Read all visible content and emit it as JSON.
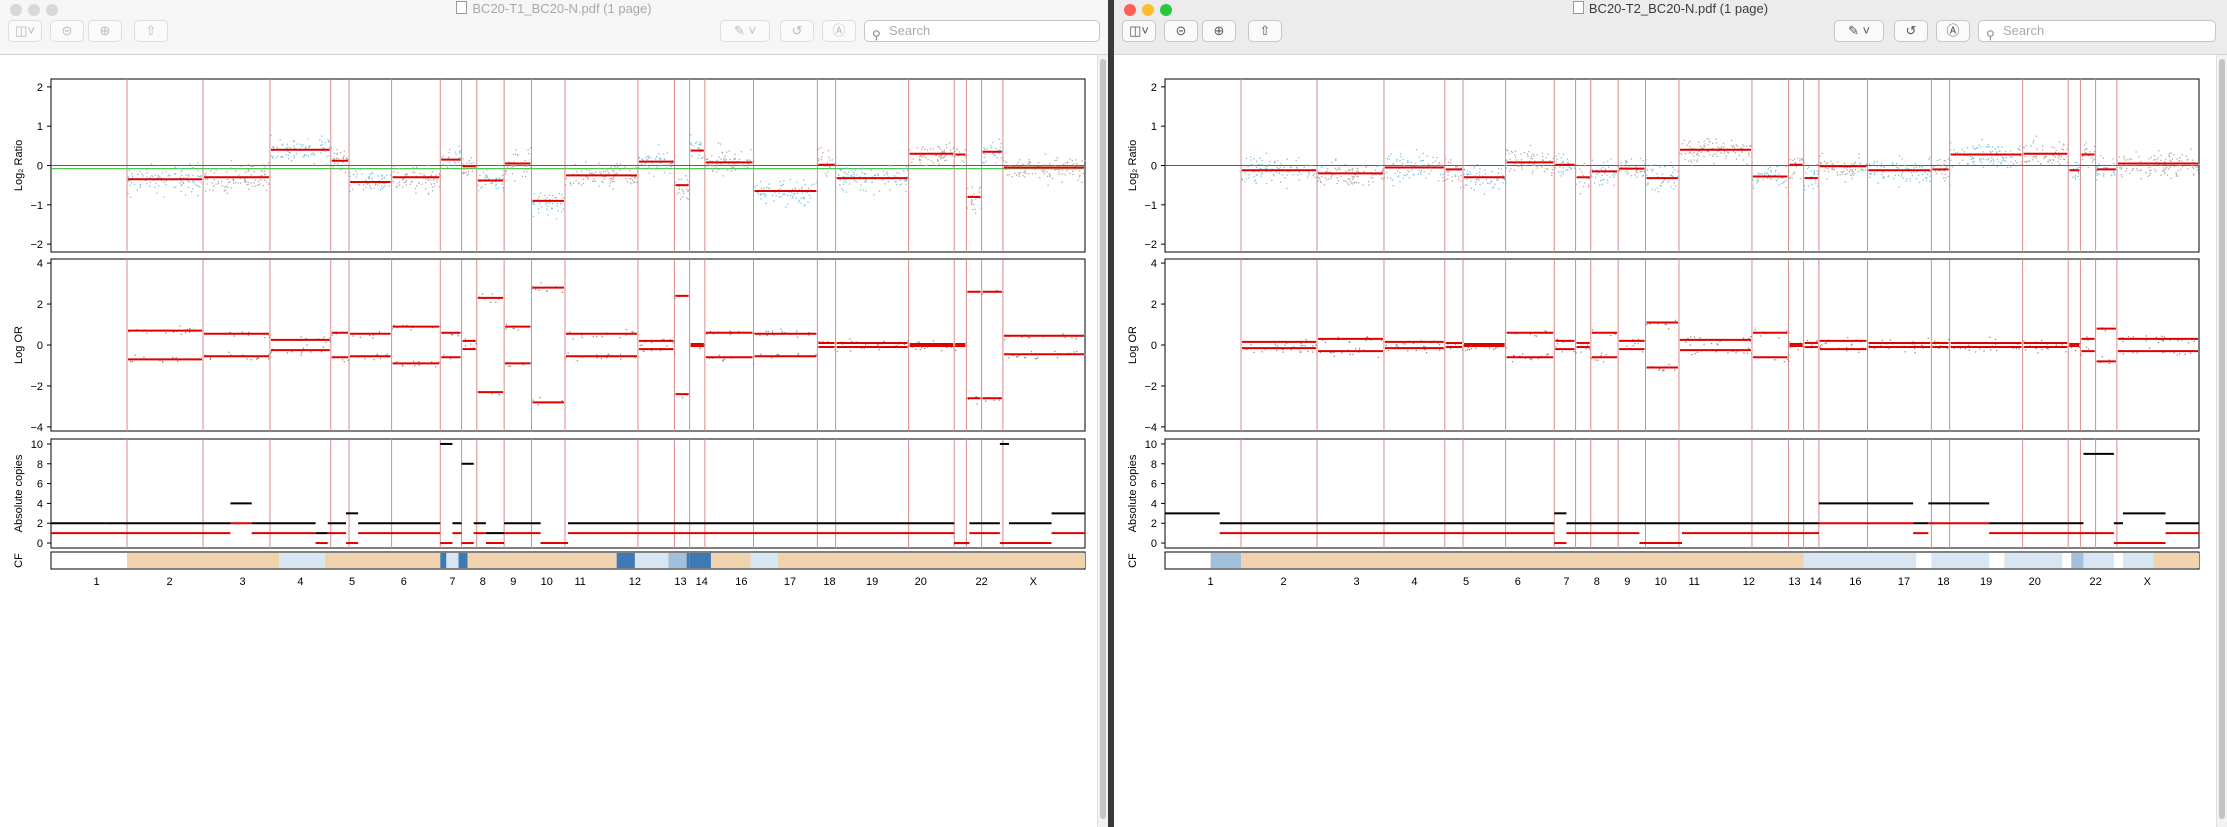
{
  "windows": [
    {
      "id": "left",
      "title": "BC20-T1_BC20-N.pdf (1 page)",
      "active": false,
      "search_placeholder": "Search",
      "cn_tracks": [
        [
          [
            0,
            1.8,
            2
          ],
          [
            1.8,
            5.9,
            2
          ],
          [
            5.9,
            6.6,
            4
          ],
          [
            6.6,
            8.7,
            2
          ],
          [
            8.7,
            9.1,
            1
          ],
          [
            9.1,
            9.7,
            2
          ],
          [
            9.7,
            10.1,
            3
          ],
          [
            10.1,
            12.8,
            2
          ],
          [
            12.8,
            13.2,
            10
          ],
          [
            13.2,
            13.5,
            2
          ],
          [
            13.5,
            13.9,
            8
          ],
          [
            13.9,
            14.3,
            2
          ],
          [
            14.3,
            14.9,
            1
          ],
          [
            14.9,
            16.1,
            2
          ],
          [
            16.1,
            17.0,
            0
          ],
          [
            17.0,
            29.7,
            2
          ],
          [
            29.7,
            30.2,
            0
          ],
          [
            30.2,
            31.2,
            2
          ],
          [
            31.2,
            31.5,
            10
          ],
          [
            31.5,
            32.9,
            2
          ],
          [
            32.9,
            34.0,
            3
          ]
        ],
        [
          [
            0,
            5.9,
            1
          ],
          [
            5.9,
            6.6,
            2
          ],
          [
            6.6,
            8.7,
            1
          ],
          [
            8.7,
            9.1,
            0
          ],
          [
            9.1,
            9.7,
            1
          ],
          [
            9.7,
            10.1,
            0
          ],
          [
            10.1,
            12.8,
            1
          ],
          [
            12.8,
            13.2,
            0
          ],
          [
            13.2,
            13.5,
            1
          ],
          [
            13.5,
            13.9,
            0
          ],
          [
            13.9,
            14.3,
            1
          ],
          [
            14.3,
            14.9,
            0
          ],
          [
            14.9,
            16.1,
            1
          ],
          [
            16.1,
            17.0,
            0
          ],
          [
            17.0,
            29.7,
            1
          ],
          [
            29.7,
            30.2,
            0
          ],
          [
            30.2,
            31.2,
            1
          ],
          [
            31.2,
            31.5,
            0
          ],
          [
            31.5,
            32.9,
            0
          ],
          [
            32.9,
            34.0,
            1
          ]
        ]
      ]
    },
    {
      "id": "right",
      "title": "BC20-T2_BC20-N.pdf (1 page)",
      "active": true,
      "search_placeholder": "Search",
      "cn_tracks": [
        [
          [
            0,
            1.8,
            3
          ],
          [
            1.8,
            12.8,
            2
          ],
          [
            12.8,
            13.2,
            3
          ],
          [
            13.2,
            15.6,
            2
          ],
          [
            15.6,
            17.0,
            2
          ],
          [
            17.0,
            21.5,
            2
          ],
          [
            21.5,
            24.6,
            4
          ],
          [
            24.6,
            25.1,
            2
          ],
          [
            25.1,
            27.1,
            4
          ],
          [
            27.1,
            29.7,
            2
          ],
          [
            29.7,
            30.2,
            2
          ],
          [
            30.2,
            31.2,
            9
          ],
          [
            31.2,
            31.5,
            2
          ],
          [
            31.5,
            32.9,
            3
          ],
          [
            32.9,
            34.0,
            2
          ]
        ],
        [
          [
            1.8,
            12.8,
            1
          ],
          [
            12.8,
            13.2,
            0
          ],
          [
            13.2,
            15.6,
            1
          ],
          [
            15.6,
            17.0,
            0
          ],
          [
            17.0,
            21.5,
            1
          ],
          [
            21.5,
            24.6,
            2
          ],
          [
            24.6,
            25.1,
            1
          ],
          [
            25.1,
            27.1,
            2
          ],
          [
            27.1,
            29.7,
            1
          ],
          [
            29.7,
            30.2,
            1
          ],
          [
            30.2,
            31.2,
            1
          ],
          [
            31.2,
            31.5,
            0
          ],
          [
            31.5,
            32.9,
            0
          ],
          [
            32.9,
            34.0,
            1
          ]
        ]
      ]
    }
  ],
  "chart": {
    "panels": [
      {
        "ylabel": "Log₂ Ratio",
        "ylim": [
          -2.2,
          2.2
        ],
        "ticks": [
          "2",
          "1",
          "0",
          "−1",
          "−2"
        ],
        "tickvals": [
          2,
          1,
          0,
          -1,
          -2
        ]
      },
      {
        "ylabel": "Log OR",
        "ylim": [
          -4.2,
          4.2
        ],
        "ticks": [
          "4",
          "2",
          "0",
          "−2",
          "−4"
        ],
        "tickvals": [
          4,
          2,
          0,
          -2,
          -4
        ]
      },
      {
        "ylabel": "Absolute copies",
        "ylim": [
          -0.5,
          10.5
        ],
        "ticks": [
          "10",
          "8",
          "6",
          "4",
          "2",
          "0"
        ],
        "tickvals": [
          10,
          8,
          6,
          4,
          2,
          0
        ]
      }
    ],
    "cf_label": "CF",
    "chromosome_labels": [
      "1",
      "2",
      "3",
      "4",
      "5",
      "6",
      "7",
      "8",
      "9",
      "10",
      "11",
      "12",
      "13",
      "14",
      "16",
      "17",
      "18",
      "19",
      "20",
      "22",
      "X"
    ],
    "chromosome_label_positions": [
      1.5,
      3.9,
      6.3,
      8.2,
      9.9,
      11.6,
      13.2,
      14.2,
      15.2,
      16.3,
      17.4,
      19.2,
      20.7,
      21.4,
      22.7,
      24.3,
      25.6,
      27.0,
      28.6,
      30.6,
      32.3
    ],
    "boundaries": [
      0,
      2.5,
      5.0,
      7.2,
      9.2,
      9.8,
      11.2,
      12.8,
      13.5,
      14.0,
      14.9,
      15.8,
      16.9,
      19.3,
      20.5,
      21.0,
      21.5,
      23.1,
      25.2,
      25.8,
      28.2,
      29.7,
      30.1,
      30.6,
      31.3,
      34.0
    ]
  },
  "colors": {
    "segment": "#e00000",
    "copy_major": "#000000",
    "copy_minor": "#e00000",
    "point_a": "#7ec3de",
    "point_b": "#b4a8a8",
    "boundary": "#d98a8a",
    "cf_tan": "#f0d3ad",
    "cf_light": "#d7e6f2",
    "cf_mid": "#a2c0dc",
    "cf_dark": "#3d7ab5",
    "zero_line": "#5a4ec0",
    "green_line": "#50c850"
  }
}
